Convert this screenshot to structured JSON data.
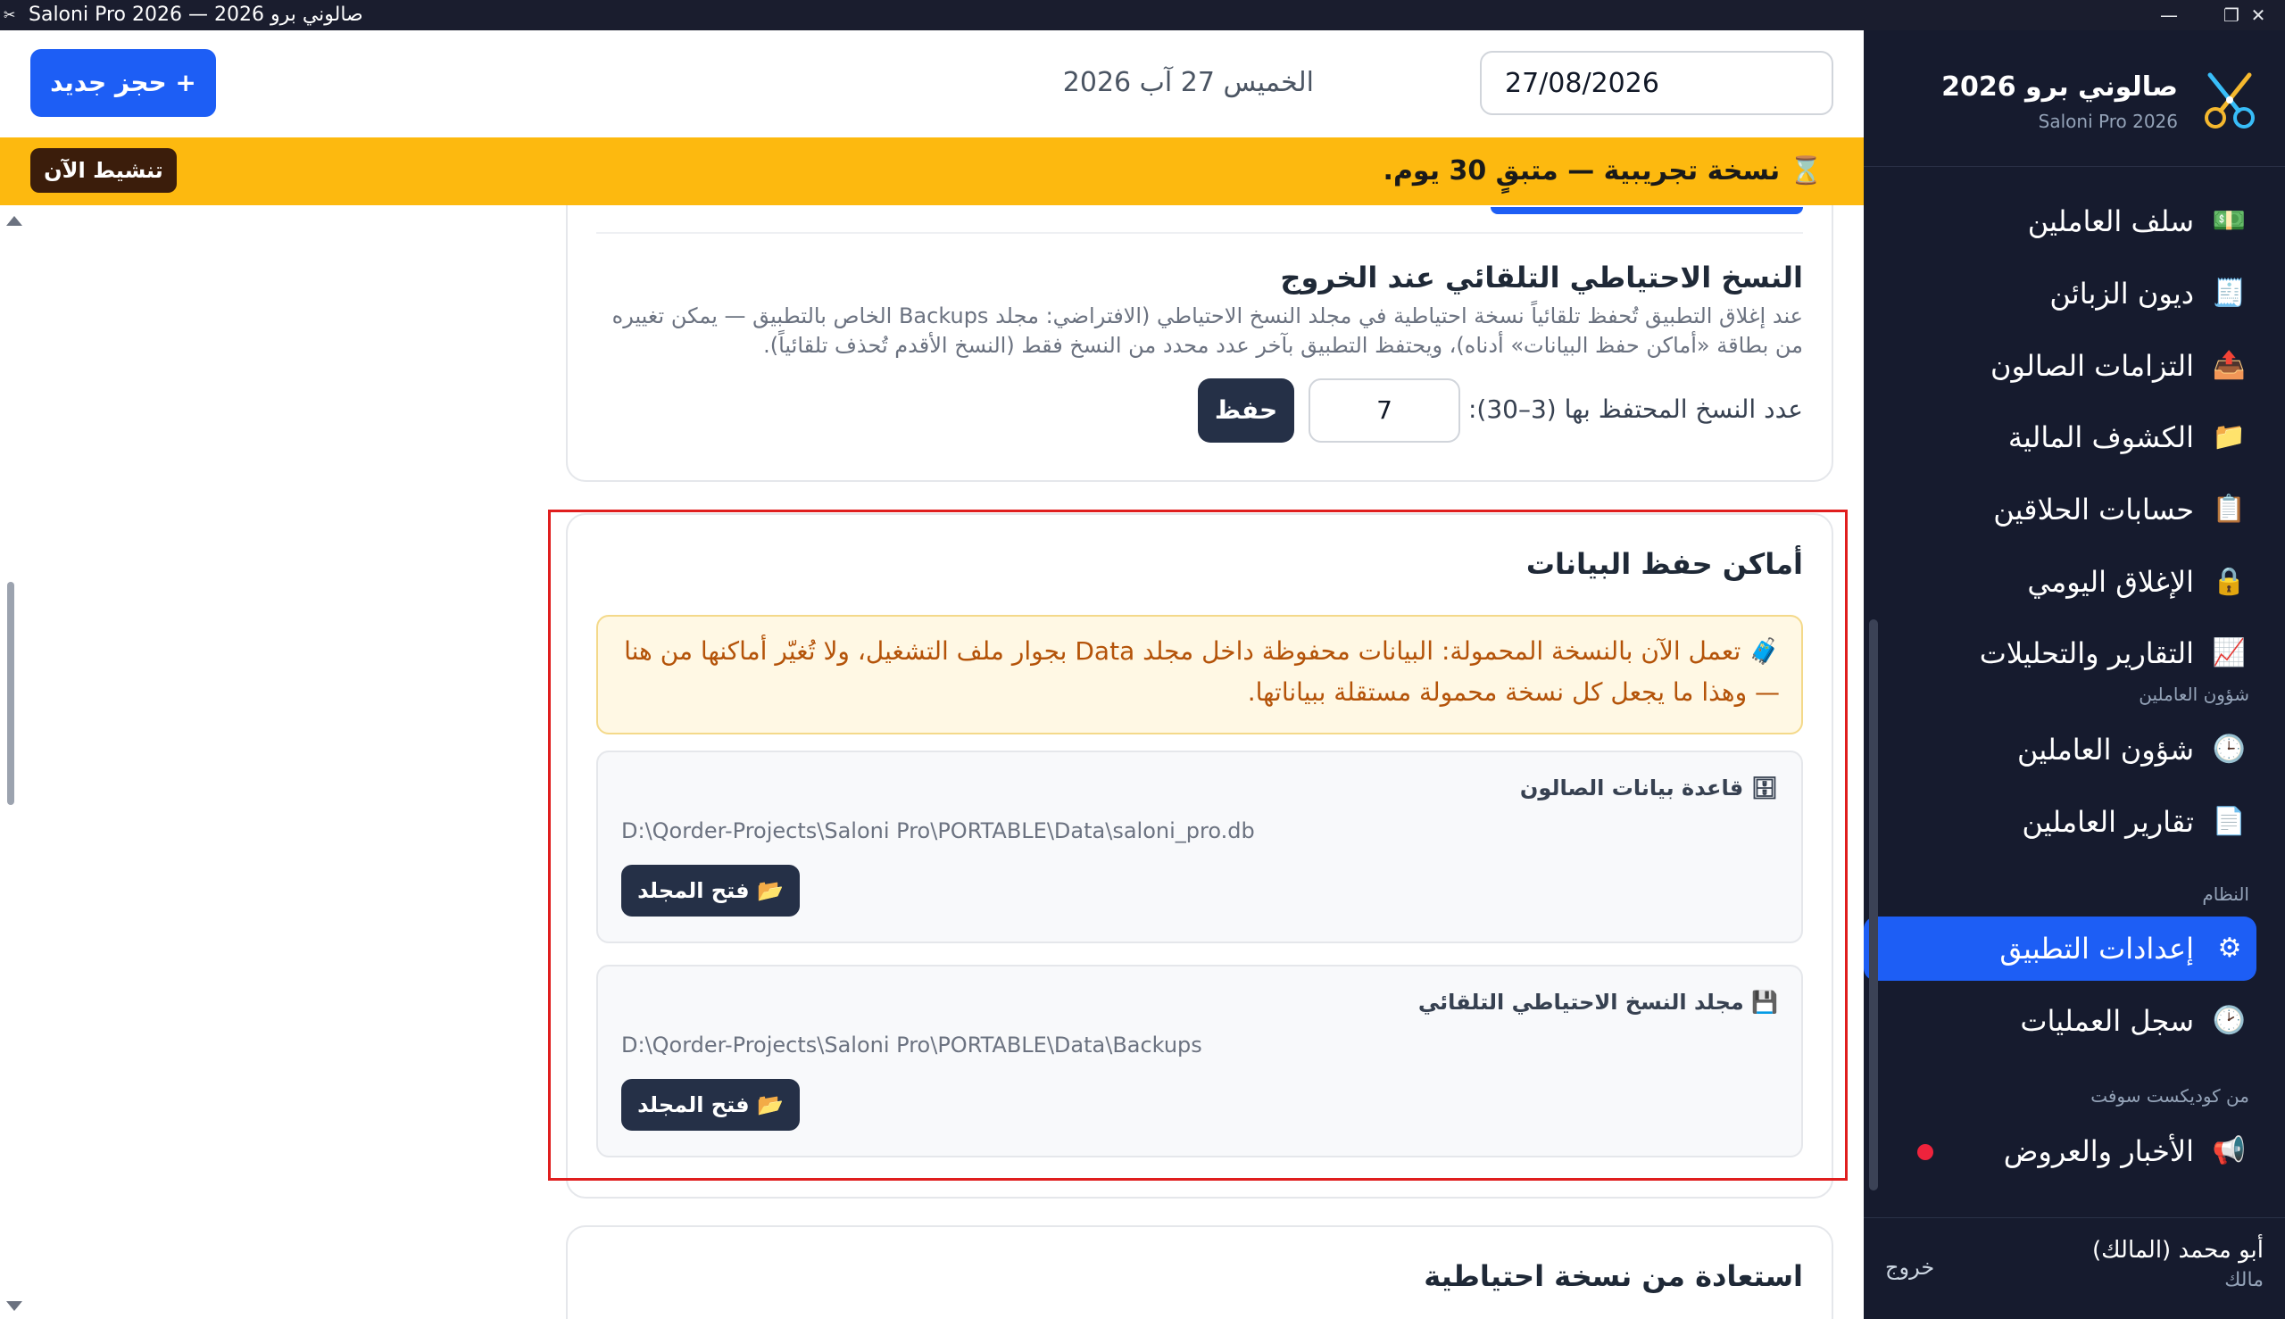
{
  "window": {
    "title": "صالوني برو 2026 — Saloni Pro 2026",
    "buttons": {
      "minimize": "—",
      "maximize": "❐",
      "close": "✕"
    }
  },
  "topbar": {
    "new_booking_label": "+ حجز جديد",
    "date_value": "27/08/2026",
    "date_text": "الخميس 27 آب 2026"
  },
  "trial": {
    "icon": "hourglass-icon",
    "message": "⌛ نسخة تجريبية — متبقٍ 30 يوم.",
    "activate_label": "تنشيط الآن"
  },
  "sidebar": {
    "brand_name": "صالوني برو 2026",
    "brand_sub": "Saloni Pro 2026",
    "items": [
      {
        "label": "سلف العاملين",
        "icon": "💵"
      },
      {
        "label": "ديون الزبائن",
        "icon": "🧾"
      },
      {
        "label": "التزامات الصالون",
        "icon": "📤"
      },
      {
        "label": "الكشوف المالية",
        "icon": "📁"
      },
      {
        "label": "حسابات الحلاقين",
        "icon": "📋"
      },
      {
        "label": "الإغلاق اليومي",
        "icon": "🔒"
      },
      {
        "label": "التقارير والتحليلات",
        "icon": "📈"
      }
    ],
    "section_staff": "شؤون العاملين",
    "staff_items": [
      {
        "label": "شؤون العاملين",
        "icon": "🕒"
      },
      {
        "label": "تقارير العاملين",
        "icon": "📄"
      }
    ],
    "section_system": "النظام",
    "system_items": [
      {
        "label": "إعدادات التطبيق",
        "icon": "⚙"
      },
      {
        "label": "سجل العمليات",
        "icon": "🕑"
      }
    ],
    "section_vendor": "من كوديكست سوفت",
    "vendor_items": [
      {
        "label": "الأخبار والعروض",
        "icon": "📢"
      }
    ],
    "active_item": "إعدادات التطبيق",
    "user_name": "أبو محمد (المالك)",
    "user_role": "مالك",
    "logout_label": "خروج"
  },
  "auto_backup": {
    "title": "النسخ الاحتياطي التلقائي عند الخروج",
    "description": "عند إغلاق التطبيق تُحفظ تلقائياً نسخة احتياطية في مجلد النسخ الاحتياطي (الافتراضي: مجلد Backups الخاص بالتطبيق — يمكن تغييره من بطاقة «أماكن حفظ البيانات» أدناه)، ويحتفظ التطبيق بآخر عدد محدد من النسخ فقط (النسخ الأقدم تُحذف تلقائياً).",
    "count_label": "عدد النسخ المحتفظ بها (3–30):",
    "count_value": "7",
    "save_label": "حفظ"
  },
  "data_locations": {
    "title": "أماكن حفظ البيانات",
    "portable_note": "🧳 تعمل الآن بالنسخة المحمولة: البيانات محفوظة داخل مجلد Data بجوار ملف التشغيل، ولا تُغيّر أماكنها من هنا — وهذا ما يجعل كل نسخة محمولة مستقلة ببياناتها.",
    "database": {
      "title": "🗄 قاعدة بيانات الصالون",
      "path": "D:\\Qorder-Projects\\Saloni Pro\\PORTABLE\\Data\\saloni_pro.db",
      "open_label": "📂 فتح المجلد"
    },
    "backup_folder": {
      "title": "💾 مجلد النسخ الاحتياطي التلقائي",
      "path": "D:\\Qorder-Projects\\Saloni Pro\\PORTABLE\\Data\\Backups",
      "open_label": "📂 فتح المجلد"
    }
  },
  "restore": {
    "title": "استعادة من نسخة احتياطية"
  },
  "colors": {
    "sidebar_bg": "#161b2e",
    "accent": "#1d5ef5",
    "trial_bg": "#fdb90f",
    "highlight": "#e01e1e",
    "dark_button": "#253047",
    "news_dot": "#ef233c"
  }
}
